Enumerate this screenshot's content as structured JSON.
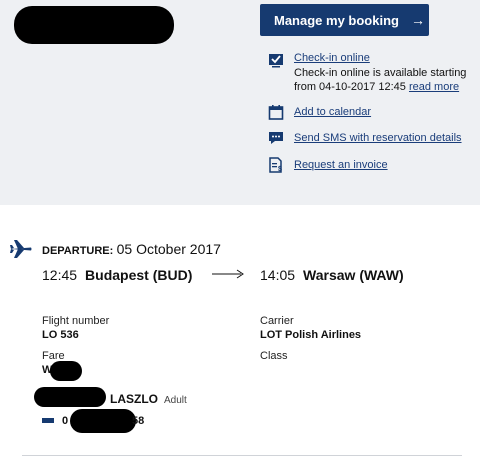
{
  "header": {
    "manage_button": "Manage my booking",
    "manage_arrow": "→"
  },
  "actions": {
    "checkin_label": "Check-in online",
    "checkin_line1": "Check-in online is available starting",
    "checkin_line2": "from 04-10-2017 12:45",
    "read_more": "read more",
    "calendar": "Add to calendar",
    "sms": "Send SMS with reservation details",
    "invoice": "Request an invoice"
  },
  "flight": {
    "departure_label": "DEPARTURE:",
    "departure_date": "05 October 2017",
    "dep_time": "12:45",
    "dep_city": "Budapest (BUD)",
    "arr_time": "14:05",
    "arr_city": "Warsaw (WAW)",
    "flight_number_label": "Flight number",
    "flight_number": "LO 536",
    "carrier_label": "Carrier",
    "carrier": "LOT Polish Airlines",
    "fare_label": "Fare",
    "fare": "W   AN",
    "class_label": "Class",
    "passenger_name": "LASZLO",
    "passenger_type": "Adult",
    "ticket_visible_prefix": "0",
    "ticket_visible_suffix": "58"
  },
  "colors": {
    "brand": "#163a70",
    "link": "#1a3d7a",
    "panel": "#eef0f3"
  }
}
